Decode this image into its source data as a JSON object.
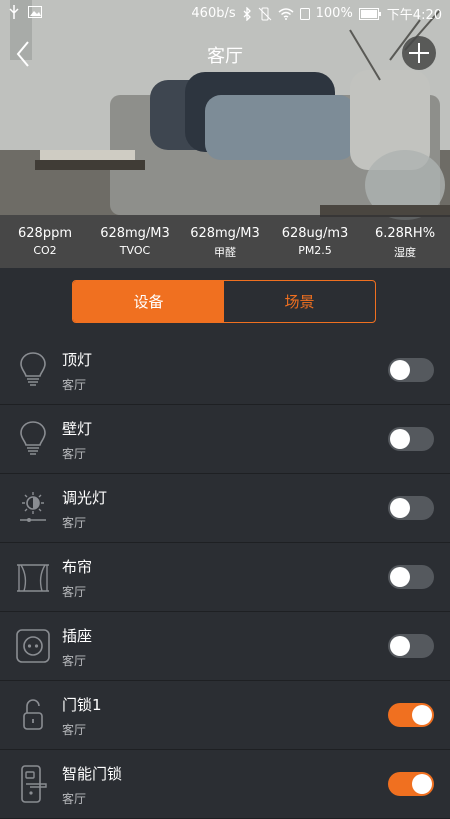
{
  "status_bar": {
    "speed": "460b/s",
    "battery": "100%",
    "time": "下午4:20"
  },
  "header": {
    "title": "客厅"
  },
  "sensors": [
    {
      "value": "628ppm",
      "label": "CO2"
    },
    {
      "value": "628mg/M3",
      "label": "TVOC"
    },
    {
      "value": "628mg/M3",
      "label": "甲醛"
    },
    {
      "value": "628ug/m3",
      "label": "PM2.5"
    },
    {
      "value": "6.28RH%",
      "label": "湿度"
    }
  ],
  "tabs": [
    {
      "label": "设备",
      "active": true
    },
    {
      "label": "场景",
      "active": false
    }
  ],
  "devices": [
    {
      "name": "顶灯",
      "room": "客厅",
      "icon": "bulb-icon",
      "on": false
    },
    {
      "name": "壁灯",
      "room": "客厅",
      "icon": "bulb-icon",
      "on": false
    },
    {
      "name": "调光灯",
      "room": "客厅",
      "icon": "dimmer-icon",
      "on": false
    },
    {
      "name": "布帘",
      "room": "客厅",
      "icon": "curtain-icon",
      "on": false
    },
    {
      "name": "插座",
      "room": "客厅",
      "icon": "socket-icon",
      "on": false
    },
    {
      "name": "门锁1",
      "room": "客厅",
      "icon": "padlock-icon",
      "on": true
    },
    {
      "name": "智能门锁",
      "room": "客厅",
      "icon": "door-lock-icon",
      "on": true
    }
  ],
  "colors": {
    "accent": "#f07020",
    "background": "#2b2e33",
    "toggle_off": "#55595e"
  }
}
